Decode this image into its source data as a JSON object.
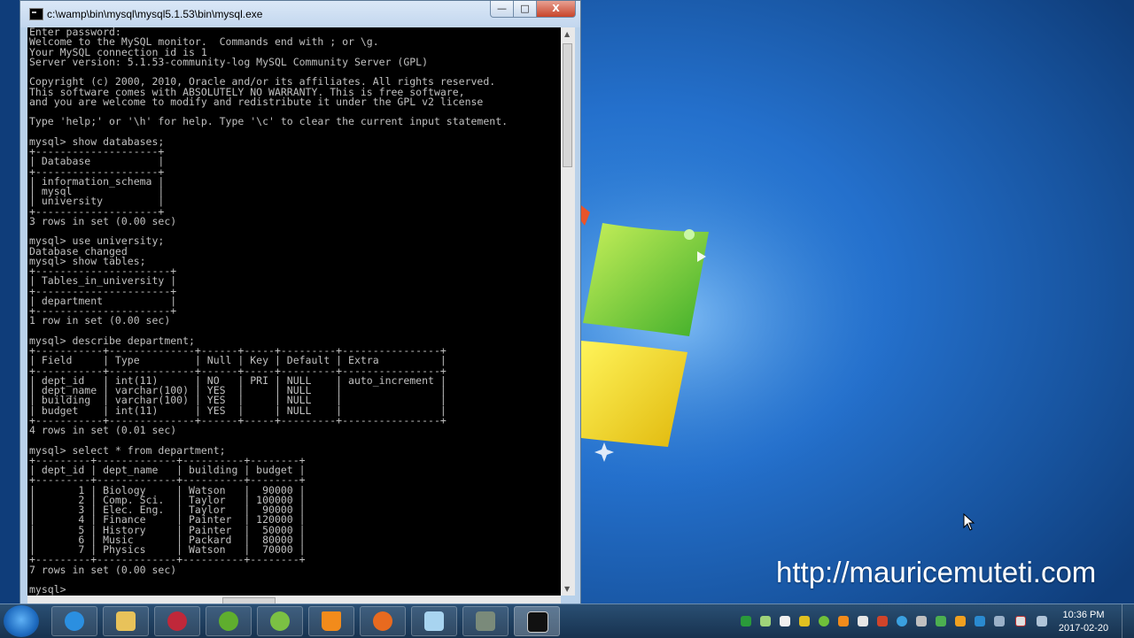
{
  "window": {
    "title": "c:\\wamp\\bin\\mysql\\mysql5.1.53\\bin\\mysql.exe",
    "min_label": "—",
    "max_label": "□",
    "close_label": "X"
  },
  "console_text": "Enter password:\nWelcome to the MySQL monitor.  Commands end with ; or \\g.\nYour MySQL connection id is 1\nServer version: 5.1.53-community-log MySQL Community Server (GPL)\n\nCopyright (c) 2000, 2010, Oracle and/or its affiliates. All rights reserved.\nThis software comes with ABSOLUTELY NO WARRANTY. This is free software,\nand you are welcome to modify and redistribute it under the GPL v2 license\n\nType 'help;' or '\\h' for help. Type '\\c' to clear the current input statement.\n\nmysql> show databases;\n+--------------------+\n| Database           |\n+--------------------+\n| information_schema |\n| mysql              |\n| university         |\n+--------------------+\n3 rows in set (0.00 sec)\n\nmysql> use university;\nDatabase changed\nmysql> show tables;\n+----------------------+\n| Tables_in_university |\n+----------------------+\n| department           |\n+----------------------+\n1 row in set (0.00 sec)\n\nmysql> describe department;\n+-----------+--------------+------+-----+---------+----------------+\n| Field     | Type         | Null | Key | Default | Extra          |\n+-----------+--------------+------+-----+---------+----------------+\n| dept_id   | int(11)      | NO   | PRI | NULL    | auto_increment |\n| dept_name | varchar(100) | YES  |     | NULL    |                |\n| building  | varchar(100) | YES  |     | NULL    |                |\n| budget    | int(11)      | YES  |     | NULL    |                |\n+-----------+--------------+------+-----+---------+----------------+\n4 rows in set (0.01 sec)\n\nmysql> select * from department;\n+---------+-------------+----------+--------+\n| dept_id | dept_name   | building | budget |\n+---------+-------------+----------+--------+\n|       1 | Biology     | Watson   |  90000 |\n|       2 | Comp. Sci.  | Taylor   | 100000 |\n|       3 | Elec. Eng.  | Taylor   |  90000 |\n|       4 | Finance     | Painter  | 120000 |\n|       5 | History     | Painter  |  50000 |\n|       6 | Music       | Packard  |  80000 |\n|       7 | Physics     | Watson   |  70000 |\n+---------+-------------+----------+--------+\n7 rows in set (0.00 sec)\n\nmysql> ",
  "desktop": {
    "watermark": "http://mauricemuteti.com"
  },
  "taskbar": {
    "apps": [
      "ie-icon",
      "explorer-icon",
      "app-icon",
      "utorrent-icon",
      "network-icon",
      "vlc-icon",
      "firefox-icon",
      "notes-icon",
      "tool-icon",
      "cmd-icon"
    ],
    "clock_time": "10:36 PM",
    "clock_date": "2017-02-20"
  },
  "colors": {
    "console_bg": "#000000",
    "console_fg": "#c0c0c0",
    "desktop_blue": "#2470cc"
  }
}
